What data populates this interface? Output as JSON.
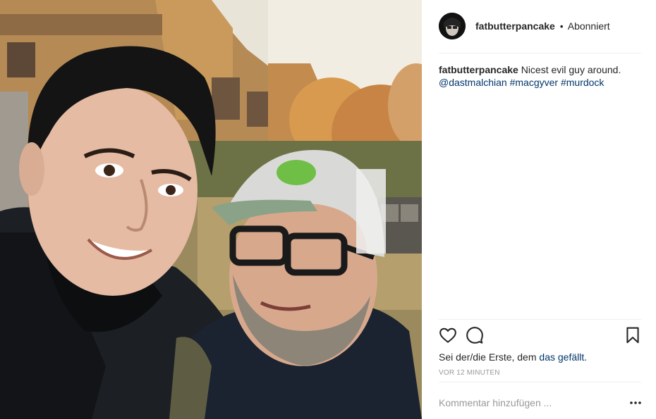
{
  "post": {
    "username": "fatbutterpancake",
    "separator": "•",
    "follow_status": "Abonniert"
  },
  "caption": {
    "username": "fatbutterpancake",
    "text": "Nicest evil guy around.",
    "mention": "@dastmalchian",
    "hashtag_1": "#macgyver",
    "hashtag_2": "#murdock"
  },
  "actions": {
    "like_icon": "heart-icon",
    "comment_icon": "comment-icon",
    "save_icon": "bookmark-icon"
  },
  "likes": {
    "prefix": "Sei der/die Erste, dem",
    "link": "das gefällt",
    "suffix": "."
  },
  "timestamp": "VOR 12 MINUTEN",
  "comment": {
    "placeholder": "Kommentar hinzufügen ...",
    "more_icon": "more-options-icon"
  },
  "colors": {
    "link": "#003569",
    "muted": "#999999",
    "text": "#262626",
    "divider": "#efefef"
  }
}
